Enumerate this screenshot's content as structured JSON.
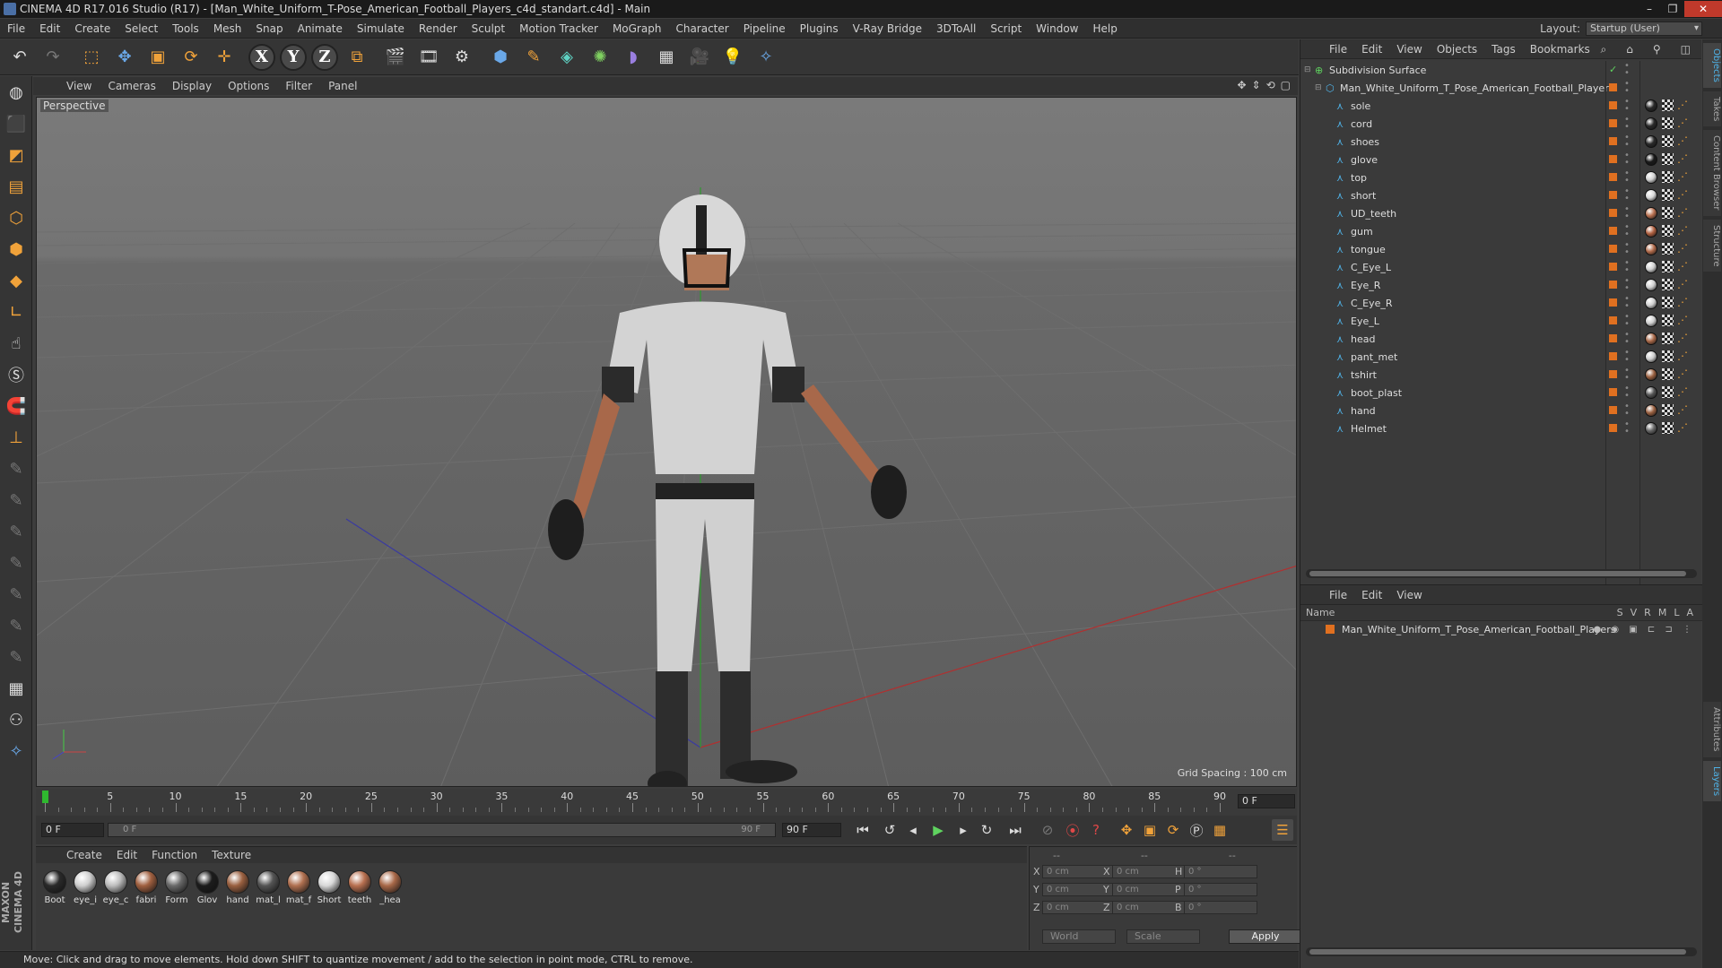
{
  "window": {
    "title": "CINEMA 4D R17.016 Studio (R17) - [Man_White_Uniform_T-Pose_American_Football_Players_c4d_standart.c4d] - Main"
  },
  "menubar": {
    "items": [
      "File",
      "Edit",
      "Create",
      "Select",
      "Tools",
      "Mesh",
      "Snap",
      "Animate",
      "Simulate",
      "Render",
      "Sculpt",
      "Motion Tracker",
      "MoGraph",
      "Character",
      "Pipeline",
      "Plugins",
      "V-Ray Bridge",
      "3DToAll",
      "Script",
      "Window",
      "Help"
    ],
    "layout_label": "Layout:",
    "layout_value": "Startup (User)"
  },
  "viewport": {
    "menu": [
      "View",
      "Cameras",
      "Display",
      "Options",
      "Filter",
      "Panel"
    ],
    "view_name": "Perspective",
    "grid_spacing": "Grid Spacing : 100 cm"
  },
  "timeline": {
    "ticks": [
      "0",
      "5",
      "10",
      "15",
      "20",
      "25",
      "30",
      "35",
      "40",
      "45",
      "50",
      "55",
      "60",
      "65",
      "70",
      "75",
      "80",
      "85",
      "90"
    ],
    "current_frame_box": "0 F"
  },
  "transport": {
    "start_field": "0 F",
    "slider_left": "0 F",
    "slider_right": "90 F",
    "end_field": "90 F"
  },
  "materials": {
    "menu": [
      "Create",
      "Edit",
      "Function",
      "Texture"
    ],
    "items": [
      {
        "name": "Boot",
        "color": "#2a2a2a"
      },
      {
        "name": "eye_i",
        "color": "#cfcfcf"
      },
      {
        "name": "eye_c",
        "color": "#bdbdbd"
      },
      {
        "name": "fabri",
        "color": "#a06040"
      },
      {
        "name": "Form",
        "color": "#6a6a6a"
      },
      {
        "name": "Glov",
        "color": "#1c1c1c"
      },
      {
        "name": "hand",
        "color": "#9a6040"
      },
      {
        "name": "mat_l",
        "color": "#555555"
      },
      {
        "name": "mat_f",
        "color": "#b07050"
      },
      {
        "name": "Short",
        "color": "#d8d8d8"
      },
      {
        "name": "teeth",
        "color": "#b87050"
      },
      {
        "name": "_hea",
        "color": "#a86848"
      }
    ]
  },
  "coords": {
    "header": [
      "--",
      "--",
      "--"
    ],
    "rows": [
      {
        "a": "X",
        "av": "0 cm",
        "b": "X",
        "bv": "0 cm",
        "c": "H",
        "cv": "0 °"
      },
      {
        "a": "Y",
        "av": "0 cm",
        "b": "Y",
        "bv": "0 cm",
        "c": "P",
        "cv": "0 °"
      },
      {
        "a": "Z",
        "av": "0 cm",
        "b": "Z",
        "bv": "0 cm",
        "c": "B",
        "cv": "0 °"
      }
    ],
    "world": "World",
    "scale": "Scale",
    "apply": "Apply"
  },
  "status": "Move: Click and drag to move elements. Hold down SHIFT to quantize movement / add to the selection in point mode, CTRL to remove.",
  "objects_panel": {
    "menu": [
      "File",
      "Edit",
      "View",
      "Objects",
      "Tags",
      "Bookmarks"
    ],
    "root": "Subdivision Surface",
    "group": "Man_White_Uniform_T_Pose_American_Football_Players",
    "children": [
      {
        "name": "sole",
        "tag": "#2a2a2a"
      },
      {
        "name": "cord",
        "tag": "#2a2a2a"
      },
      {
        "name": "shoes",
        "tag": "#2a2a2a"
      },
      {
        "name": "glove",
        "tag": "#1a1a1a"
      },
      {
        "name": "top",
        "tag": "#d0d0d0"
      },
      {
        "name": "short",
        "tag": "#d8d8d8"
      },
      {
        "name": "UD_teeth",
        "tag": "#b87050"
      },
      {
        "name": "gum",
        "tag": "#b06040"
      },
      {
        "name": "tongue",
        "tag": "#b06a4a"
      },
      {
        "name": "C_Eye_L",
        "tag": "#cfcfcf"
      },
      {
        "name": "Eye_R",
        "tag": "#cfcfcf"
      },
      {
        "name": "C_Eye_R",
        "tag": "#cfcfcf"
      },
      {
        "name": "Eye_L",
        "tag": "#cfcfcf"
      },
      {
        "name": "head",
        "tag": "#a86848"
      },
      {
        "name": "pant_met",
        "tag": "#cccccc"
      },
      {
        "name": "tshirt",
        "tag": "#9a6040"
      },
      {
        "name": "boot_plast",
        "tag": "#555555"
      },
      {
        "name": "hand",
        "tag": "#9a6040"
      },
      {
        "name": "Helmet",
        "tag": "#666666"
      }
    ]
  },
  "layers_panel": {
    "menu": [
      "File",
      "Edit",
      "View"
    ],
    "header_name": "Name",
    "header_cols": [
      "S",
      "V",
      "R",
      "M",
      "L",
      "A"
    ],
    "rows": [
      "Man_White_Uniform_T_Pose_American_Football_Players"
    ]
  },
  "side_tabs": [
    "Objects",
    "Takes",
    "Content Browser",
    "Structure",
    "Attributes",
    "Layers"
  ]
}
